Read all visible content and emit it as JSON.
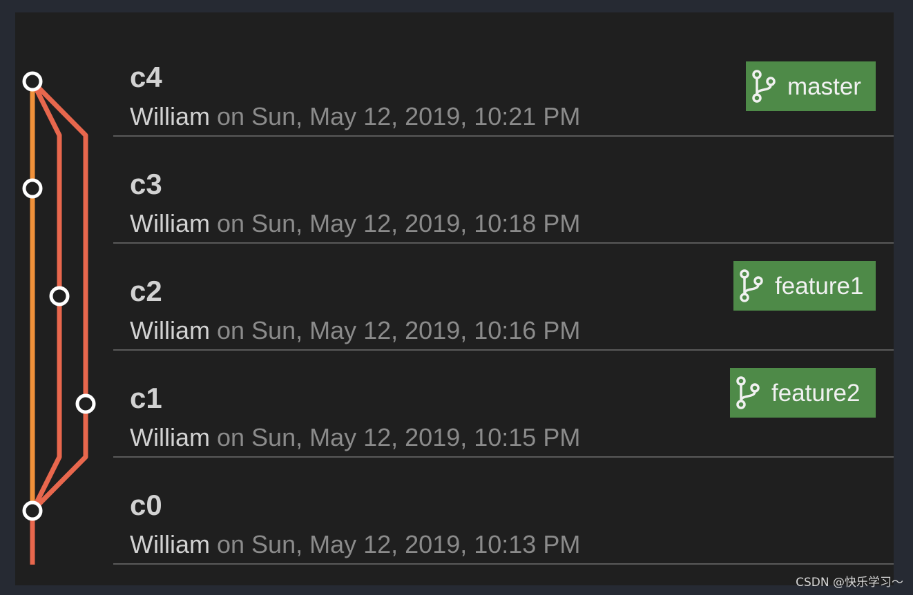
{
  "commits": [
    {
      "title": "c4",
      "author": "William",
      "date": " on Sun, May 12, 2019, 10:21 PM",
      "branch": "master"
    },
    {
      "title": "c3",
      "author": "William",
      "date": " on Sun, May 12, 2019, 10:18 PM",
      "branch": null
    },
    {
      "title": "c2",
      "author": "William",
      "date": " on Sun, May 12, 2019, 10:16 PM",
      "branch": "feature1"
    },
    {
      "title": "c1",
      "author": "William",
      "date": " on Sun, May 12, 2019, 10:15 PM",
      "branch": "feature2"
    },
    {
      "title": "c0",
      "author": "William",
      "date": " on Sun, May 12, 2019, 10:13 PM",
      "branch": null
    }
  ],
  "colors": {
    "lane_master": "#f0913a",
    "lane_feature": "#e8674d",
    "branch_tag": "#4e8a48",
    "node_border": "#ffffff",
    "node_fill": "#1f1f1f"
  },
  "icons": {
    "branch": "git-branch-icon",
    "node": "commit-node-icon"
  },
  "watermark": "CSDN @快乐学习～"
}
